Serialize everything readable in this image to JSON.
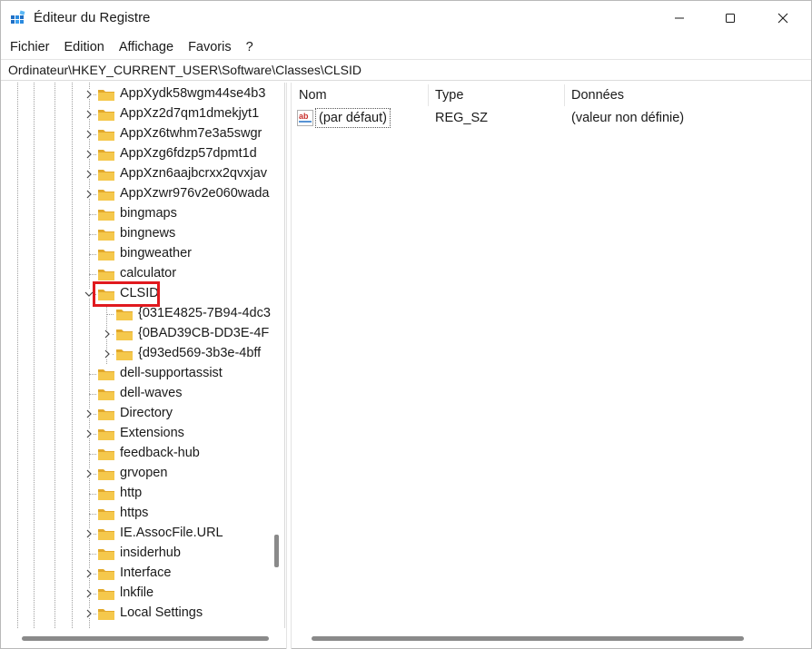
{
  "window": {
    "title": "Éditeur du Registre"
  },
  "menu": {
    "items": [
      "Fichier",
      "Edition",
      "Affichage",
      "Favoris",
      "?"
    ]
  },
  "address": {
    "path": "Ordinateur\\HKEY_CURRENT_USER\\Software\\Classes\\CLSID"
  },
  "tree": {
    "items": [
      {
        "label": "AppXydk58wgm44se4b3",
        "expandable": true,
        "level": 1
      },
      {
        "label": "AppXz2d7qm1dmekjyt1",
        "expandable": true,
        "level": 1
      },
      {
        "label": "AppXz6twhm7e3a5swgr",
        "expandable": true,
        "level": 1
      },
      {
        "label": "AppXzg6fdzp57dpmt1d",
        "expandable": true,
        "level": 1
      },
      {
        "label": "AppXzn6aajbcrxx2qvxjav",
        "expandable": true,
        "level": 1
      },
      {
        "label": "AppXzwr976v2e060wada",
        "expandable": true,
        "level": 1
      },
      {
        "label": "bingmaps",
        "expandable": false,
        "level": 1
      },
      {
        "label": "bingnews",
        "expandable": false,
        "level": 1
      },
      {
        "label": "bingweather",
        "expandable": false,
        "level": 1
      },
      {
        "label": "calculator",
        "expandable": false,
        "level": 1
      },
      {
        "label": "CLSID",
        "expandable": true,
        "expanded": true,
        "selected": true,
        "level": 1
      },
      {
        "label": "{031E4825-7B94-4dc3",
        "expandable": false,
        "level": 2
      },
      {
        "label": "{0BAD39CB-DD3E-4F",
        "expandable": true,
        "level": 2
      },
      {
        "label": "{d93ed569-3b3e-4bff",
        "expandable": true,
        "level": 2
      },
      {
        "label": "dell-supportassist",
        "expandable": false,
        "level": 1
      },
      {
        "label": "dell-waves",
        "expandable": false,
        "level": 1
      },
      {
        "label": "Directory",
        "expandable": true,
        "level": 1
      },
      {
        "label": "Extensions",
        "expandable": true,
        "level": 1
      },
      {
        "label": "feedback-hub",
        "expandable": false,
        "level": 1
      },
      {
        "label": "grvopen",
        "expandable": true,
        "level": 1
      },
      {
        "label": "http",
        "expandable": false,
        "level": 1
      },
      {
        "label": "https",
        "expandable": false,
        "level": 1
      },
      {
        "label": "IE.AssocFile.URL",
        "expandable": true,
        "level": 1
      },
      {
        "label": "insiderhub",
        "expandable": false,
        "level": 1
      },
      {
        "label": "Interface",
        "expandable": true,
        "level": 1
      },
      {
        "label": "lnkfile",
        "expandable": true,
        "level": 1
      },
      {
        "label": "Local Settings",
        "expandable": true,
        "level": 1
      }
    ]
  },
  "list": {
    "columns": [
      "Nom",
      "Type",
      "Données"
    ],
    "rows": [
      {
        "name": "(par défaut)",
        "type": "REG_SZ",
        "data": "(valeur non définie)",
        "icon": "string-value-icon"
      }
    ]
  },
  "colors": {
    "folder": "#f5c84c",
    "folder_dark": "#e2a82a",
    "highlight": "#e0191e",
    "string_icon_red": "#c8302c"
  }
}
